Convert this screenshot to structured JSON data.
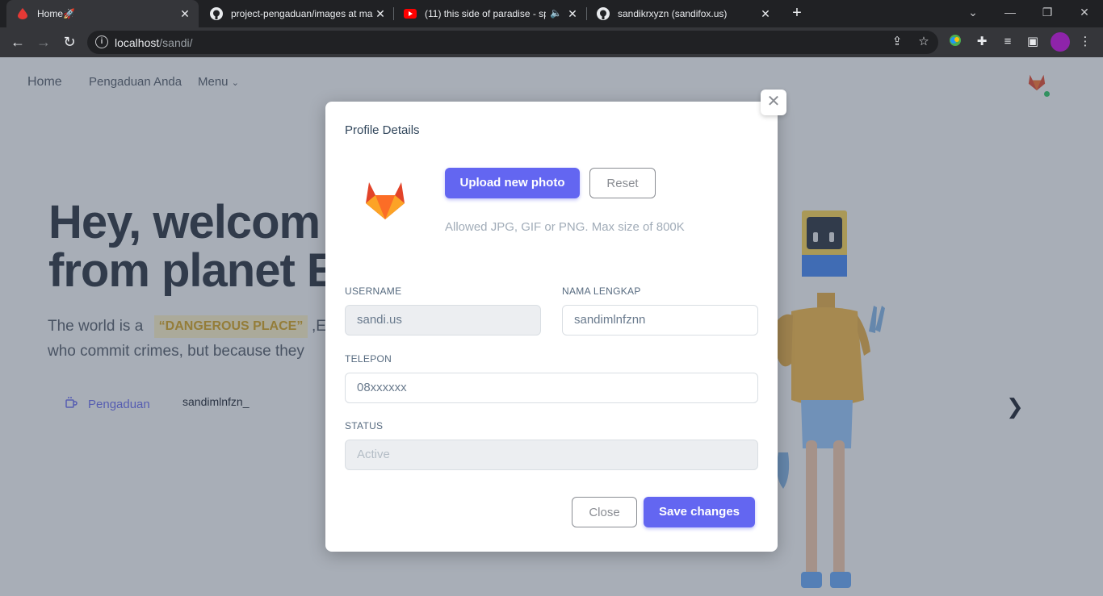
{
  "browser": {
    "tabs": [
      {
        "title": "Home🚀",
        "active": true
      },
      {
        "title": "project-pengaduan/images at ma",
        "active": false
      },
      {
        "title": "(11) this side of paradise - sp",
        "active": false
      },
      {
        "title": "sandikrxyzn (sandifox.us)",
        "active": false
      }
    ],
    "url_host": "localhost",
    "url_path": "/sandi/"
  },
  "site": {
    "nav": {
      "home": "Home",
      "pengaduan": "Pengaduan Anda",
      "menu": "Menu"
    },
    "hero_line1": "Hey, welcom",
    "hero_line2": "from planet E",
    "sub_text": "The world is a",
    "sub_highlight": "“DANGEROUS PLACE”",
    "sub_rest": ",E",
    "sub_line2": "who commit crimes, but because they",
    "pengaduan_link": "Pengaduan",
    "typed_text": "sandimlnfzn_"
  },
  "modal": {
    "title": "Profile Details",
    "upload_label": "Upload new photo",
    "reset_label": "Reset",
    "hint": "Allowed JPG, GIF or PNG. Max size of 800K",
    "username_label": "USERNAME",
    "username_value": "sandi.us",
    "fullname_label": "NAMA LENGKAP",
    "fullname_value": "sandimlnfznn",
    "phone_label": "TELEPON",
    "phone_placeholder": "08xxxxxx",
    "status_label": "STATUS",
    "status_placeholder": "Active",
    "close_label": "Close",
    "save_label": "Save changes"
  },
  "colors": {
    "primary": "#6366f1",
    "highlight_bg": "#fef3c7",
    "highlight_text": "#d4a017"
  }
}
